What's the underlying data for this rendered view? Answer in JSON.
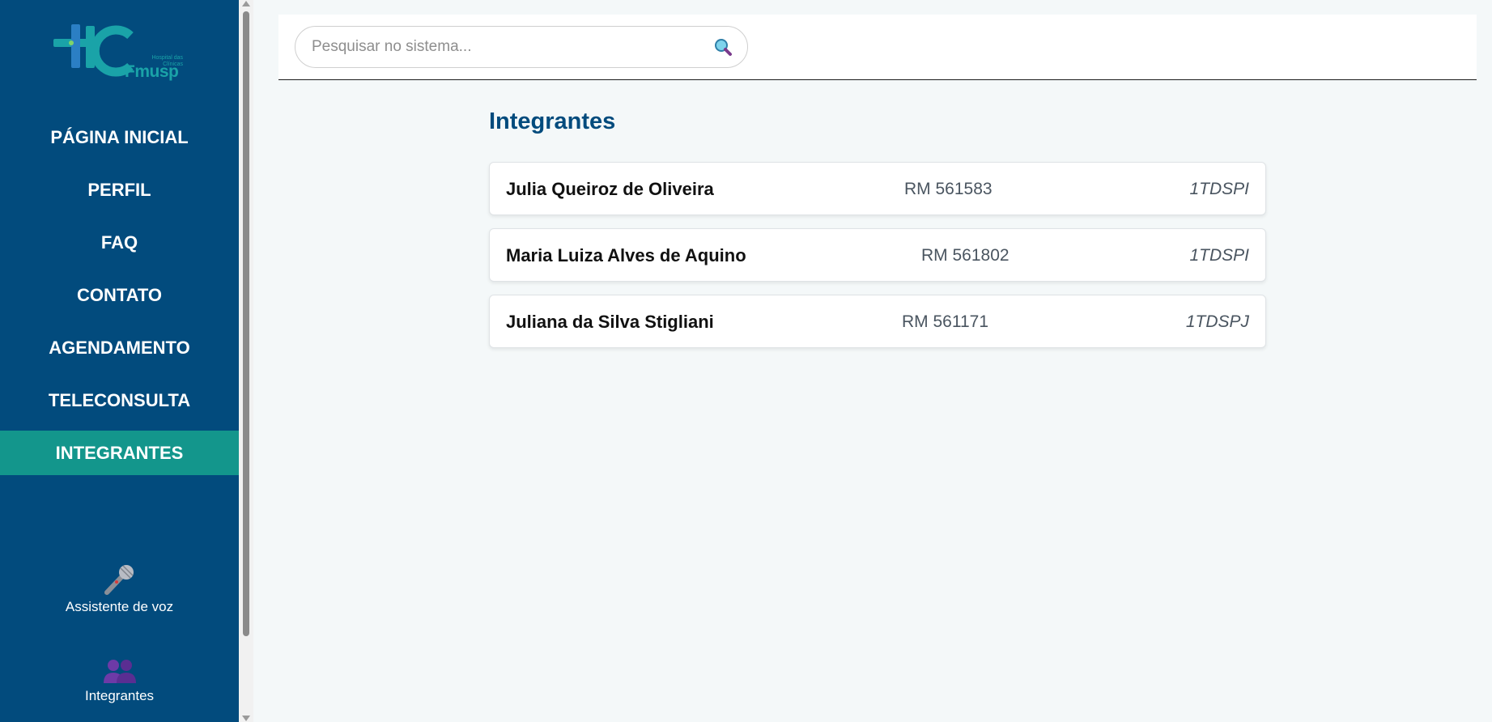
{
  "brand": {
    "logo_main": "Fmusp",
    "logo_sub": "Hospital das Clínicas",
    "colors": {
      "sidebar": "#024b7d",
      "active": "#13968c",
      "accent": "#1aa3a8"
    }
  },
  "nav": {
    "items": [
      {
        "label": "PÁGINA INICIAL",
        "active": false
      },
      {
        "label": "PERFIL",
        "active": false
      },
      {
        "label": "FAQ",
        "active": false
      },
      {
        "label": "CONTATO",
        "active": false
      },
      {
        "label": "AGENDAMENTO",
        "active": false
      },
      {
        "label": "TELECONSULTA",
        "active": false
      },
      {
        "label": "INTEGRANTES",
        "active": true
      }
    ]
  },
  "tools": {
    "voice": {
      "label": "Assistente de voz",
      "icon": "microphone-icon"
    },
    "members": {
      "label": "Integrantes",
      "icon": "people-icon"
    }
  },
  "search": {
    "placeholder": "Pesquisar no sistema...",
    "value": "",
    "icon": "search-icon"
  },
  "main": {
    "title": "Integrantes",
    "members": [
      {
        "name": "Julia Queiroz de Oliveira",
        "rm": "RM 561583",
        "class": "1TDSPI"
      },
      {
        "name": "Maria Luiza Alves de Aquino",
        "rm": "RM 561802",
        "class": "1TDSPI"
      },
      {
        "name": "Juliana da Silva Stigliani",
        "rm": "RM 561171",
        "class": "1TDSPJ"
      }
    ]
  }
}
